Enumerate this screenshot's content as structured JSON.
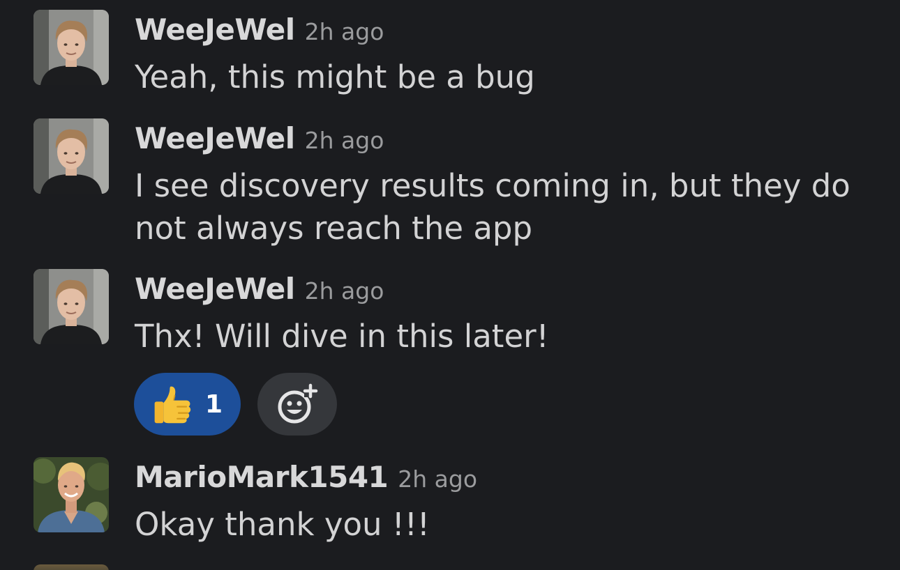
{
  "messages": [
    {
      "author": "WeeJeWel",
      "time": "2h ago",
      "text": "Yeah, this might be a bug",
      "avatar_icon": "user-avatar-photo"
    },
    {
      "author": "WeeJeWel",
      "time": "2h ago",
      "text": "I see discovery results coming in, but they do not always reach the app",
      "avatar_icon": "user-avatar-photo"
    },
    {
      "author": "WeeJeWel",
      "time": "2h ago",
      "text": "Thx! Will dive in this later!",
      "avatar_icon": "user-avatar-photo"
    },
    {
      "author": "MarioMark1541",
      "time": "2h ago",
      "text": "Okay thank you !!!",
      "avatar_icon": "user-avatar-photo"
    }
  ],
  "reactions": {
    "thumbs_up": {
      "emoji": "thumbs-up-emoji",
      "count": "1",
      "active": true
    },
    "add_reaction": {
      "icon": "add-reaction-icon"
    }
  },
  "colors": {
    "background": "#1b1c1f",
    "author": "#d8d8d9",
    "timestamp": "#9b9c9e",
    "message_text": "#d3d3d4",
    "reaction_active": "#1d4f9a",
    "reaction_add_bg": "#35373b"
  }
}
